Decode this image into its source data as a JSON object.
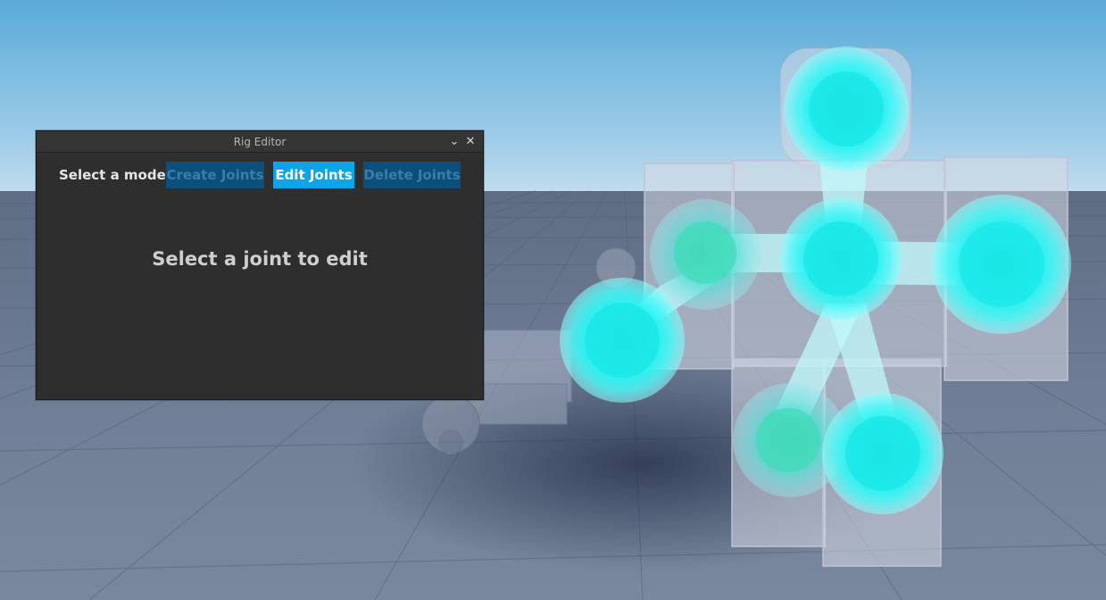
{
  "window": {
    "title": "Rig Editor",
    "collapse_icon": "chevron-down-icon",
    "close_icon": "close-icon"
  },
  "mode_row": {
    "label": "Select a mode:",
    "buttons": [
      {
        "label": "Create Joints",
        "state": "inactive"
      },
      {
        "label": "Edit Joints",
        "state": "active"
      },
      {
        "label": "Delete Joints",
        "state": "inactive"
      }
    ]
  },
  "content": {
    "message": "Select a joint to edit"
  },
  "colors": {
    "sky_top": "#5aaad8",
    "sky_horizon": "#c2dcec",
    "ground": "#6c7b93",
    "panel_bg": "#2e2e2e",
    "button_active": "#0ea4e8",
    "button_inactive": "#0b4f7a",
    "joint_cyan": "#1ff0f0"
  }
}
